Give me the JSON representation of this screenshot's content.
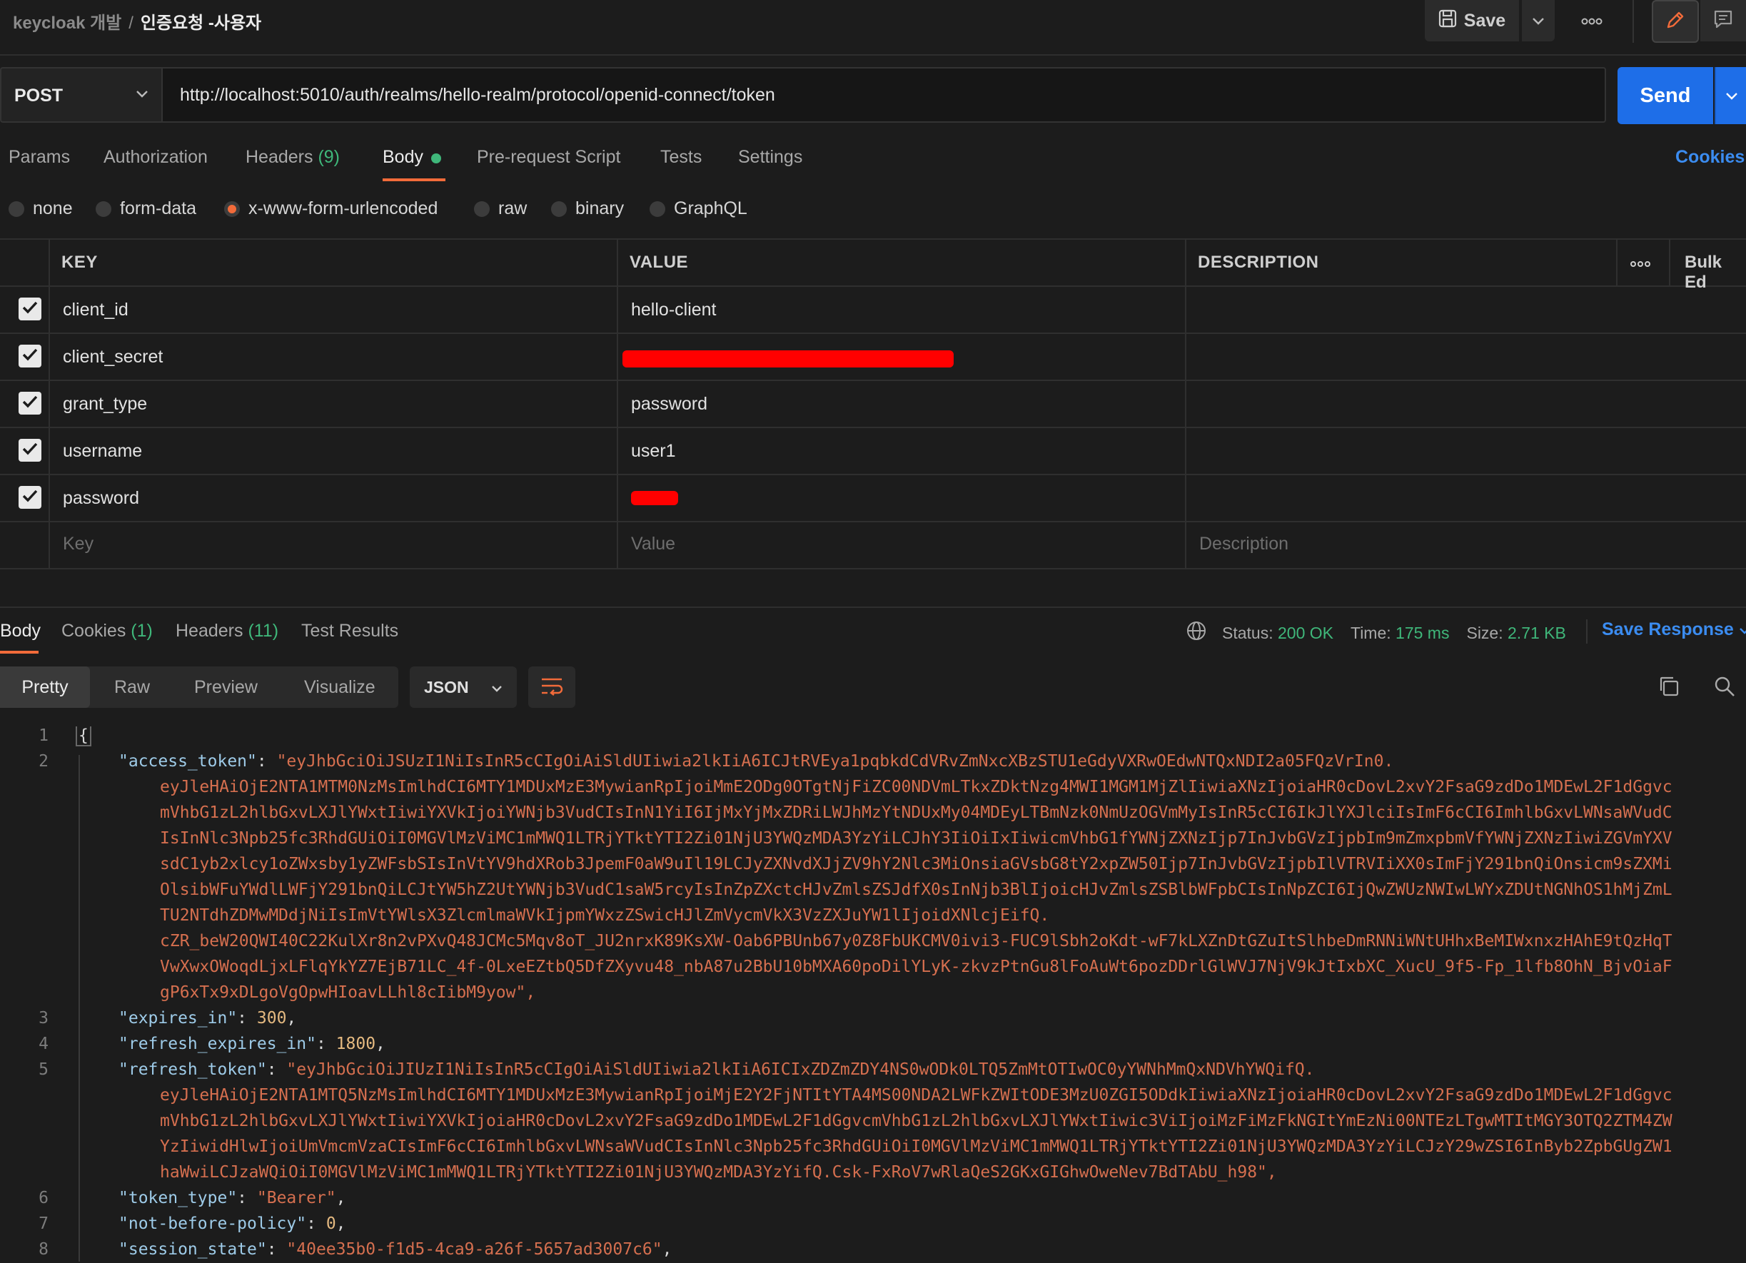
{
  "breadcrumb": {
    "workspace": "keycloak 개발",
    "separator": "/",
    "request": "인증요청 -사용자"
  },
  "toolbar": {
    "save_label": "Save"
  },
  "request": {
    "method": "POST",
    "url": "http://localhost:5010/auth/realms/hello-realm/protocol/openid-connect/token",
    "send_label": "Send"
  },
  "request_tabs": {
    "params": "Params",
    "authorization": "Authorization",
    "headers": "Headers",
    "headers_count": "(9)",
    "body": "Body",
    "pre_request": "Pre-request Script",
    "tests": "Tests",
    "settings": "Settings",
    "cookies": "Cookies"
  },
  "body_types": {
    "none": "none",
    "form_data": "form-data",
    "urlencoded": "x-www-form-urlencoded",
    "raw": "raw",
    "binary": "binary",
    "graphql": "GraphQL",
    "selected": "x-www-form-urlencoded"
  },
  "params_table": {
    "headers": {
      "key": "KEY",
      "value": "VALUE",
      "description": "DESCRIPTION",
      "bulk_edit": "Bulk Ed"
    },
    "rows": [
      {
        "key": "client_id",
        "value": "hello-client"
      },
      {
        "key": "client_secret",
        "value": ""
      },
      {
        "key": "grant_type",
        "value": "password"
      },
      {
        "key": "username",
        "value": "user1"
      },
      {
        "key": "password",
        "value": ""
      }
    ],
    "placeholders": {
      "key": "Key",
      "value": "Value",
      "description": "Description"
    }
  },
  "response_tabs": {
    "body": "Body",
    "cookies": "Cookies",
    "cookies_count": "(1)",
    "headers": "Headers",
    "headers_count": "(11)",
    "test_results": "Test Results"
  },
  "response_status": {
    "status_label": "Status:",
    "status": "200 OK",
    "time_label": "Time:",
    "time": "175 ms",
    "size_label": "Size:",
    "size": "2.71 KB",
    "save_response": "Save Response"
  },
  "view_modes": {
    "pretty": "Pretty",
    "raw": "Raw",
    "preview": "Preview",
    "visualize": "Visualize",
    "format": "JSON"
  },
  "response_lines": {
    "line_numbers": [
      "1",
      "2",
      "3",
      "4",
      "5",
      "6",
      "7",
      "8"
    ],
    "open_brace": "{",
    "access_token_key": "\"access_token\"",
    "access_token": [
      "\"eyJhbGciOiJSUzI1NiIsInR5cCIgOiAiSldUIiwia2lkIiA6ICJtRVEya1pqbkdCdVRvZmNxcXBzSTU1eGdyVXRwOEdwNTQxNDI2a05FQzVrIn0.",
      "eyJleHAiOjE2NTA1MTM0NzMsImlhdCI6MTY1MDUxMzE3MywianRpIjoiMmE2ODg0OTgtNjFiZC00NDVmLTkxZDktNzg4MWI1MGM1MjZlIiwiaXNzIjoiaHR0cDovL2xvY2FsaG9zdDo1MDEwL2F1dGgvc",
      "mVhbG1zL2hlbGxvLXJlYWxtIiwiYXVkIjoiYWNjb3VudCIsInN1YiI6IjMxYjMxZDRiLWJhMzYtNDUxMy04MDEyLTBmNzk0NmUzOGVmMyIsInR5cCI6IkJlYXJlciIsImF6cCI6ImhlbGxvLWNsaWVudC",
      "IsInNlc3Npb25fc3RhdGUiOiI0MGVlMzViMC1mMWQ1LTRjYTktYTI2Zi01NjU3YWQzMDA3YzYiLCJhY3IiOiIxIiwicmVhbG1fYWNjZXNzIjp7InJvbGVzIjpbIm9mZmxpbmVfYWNjZXNzIiwiZGVmYXV",
      "sdC1yb2xlcy1oZWxsby1yZWFsbSIsInVtYV9hdXRob3JpemF0aW9uIl19LCJyZXNvdXJjZV9hY2Nlc3MiOnsiaGVsbG8tY2xpZW50Ijp7InJvbGVzIjpbIlVTRVIiXX0sImFjY291bnQiOnsicm9sZXMi",
      "OlsibWFuYWdlLWFjY291bnQiLCJtYW5hZ2UtYWNjb3VudC1saW5rcyIsInZpZXctcHJvZmlsZSJdfX0sInNjb3BlIjoicHJvZmlsZSBlbWFpbCIsInNpZCI6IjQwZWUzNWIwLWYxZDUtNGNhOS1hMjZmL",
      "TU2NTdhZDMwMDdjNiIsImVtYWlsX3ZlcmlmaWVkIjpmYWxzZSwicHJlZmVycmVkX3VzZXJuYW1lIjoidXNlcjEifQ.",
      "cZR_beW20QWI40C22KulXr8n2vPXvQ48JCMc5Mqv8oT_JU2nrxK89KsXW-Oab6PBUnb67y0Z8FbUKCMV0ivi3-FUC9lSbh2oKdt-wF7kLXZnDtGZuItSlhbeDmRNNiWNtUHhxBeMIWxnxzHAhE9tQzHqT",
      "VwXwxOWoqdLjxLFlqYkYZ7EjB71LC_4f-0LxeEZtbQ5DfZXyvu48_nbA87u2BbU10bMXA60poDilYLyK-zkvzPtnGu8lFoAuWt6pozDDrlGlWVJ7NjV9kJtIxbXC_XucU_9f5-Fp_1lfb8OhN_BjvOiaF",
      "gP6xTx9xDLgoVgOpwHIoavLLhl8cIibM9yow\","
    ],
    "expires_in_key": "\"expires_in\"",
    "expires_in": "300",
    "refresh_expires_in_key": "\"refresh_expires_in\"",
    "refresh_expires_in": "1800",
    "refresh_token_key": "\"refresh_token\"",
    "refresh_token": [
      "\"eyJhbGciOiJIUzI1NiIsInR5cCIgOiAiSldUIiwia2lkIiA6ICIxZDZmZDY4NS0wODk0LTQ5ZmMtOTIwOC0yYWNhMmQxNDVhYWQifQ.",
      "eyJleHAiOjE2NTA1MTQ5NzMsImlhdCI6MTY1MDUxMzE3MywianRpIjoiMjE2Y2FjNTItYTA4MS00NDA2LWFkZWItODE3MzU0ZGI5ODdkIiwiaXNzIjoiaHR0cDovL2xvY2FsaG9zdDo1MDEwL2F1dGgvc",
      "mVhbG1zL2hlbGxvLXJlYWxtIiwiYXVkIjoiaHR0cDovL2xvY2FsaG9zdDo1MDEwL2F1dGgvcmVhbG1zL2hlbGxvLXJlYWxtIiwic3ViIjoiMzFiMzFkNGItYmEzNi00NTEzLTgwMTItMGY3OTQ2ZTM4ZW",
      "YzIiwidHlwIjoiUmVmcmVzaCIsImF6cCI6ImhlbGxvLWNsaWVudCIsInNlc3Npb25fc3RhdGUiOiI0MGVlMzViMC1mMWQ1LTRjYTktYTI2Zi01NjU3YWQzMDA3YzYiLCJzY29wZSI6InByb2ZpbGUgZW1",
      "haWwiLCJzaWQiOiI0MGVlMzViMC1mMWQ1LTRjYTktYTI2Zi01NjU3YWQzMDA3YzYifQ.Csk-FxRoV7wRlaQeS2GKxGIGhwOweNev7BdTAbU_h98\","
    ],
    "token_type_key": "\"token_type\"",
    "token_type": "\"Bearer\"",
    "not_before_key": "\"not-before-policy\"",
    "not_before": "0",
    "session_state_key": "\"session_state\"",
    "session_state": "\"40ee35b0-f1d5-4ca9-a26f-5657ad3007c6\""
  },
  "colors": {
    "accent": "#f26b3a",
    "send": "#1e6ee8",
    "link": "#3b8cf0",
    "success": "#3fb77a",
    "string": "#d56f4f",
    "key": "#9ecbe8"
  }
}
